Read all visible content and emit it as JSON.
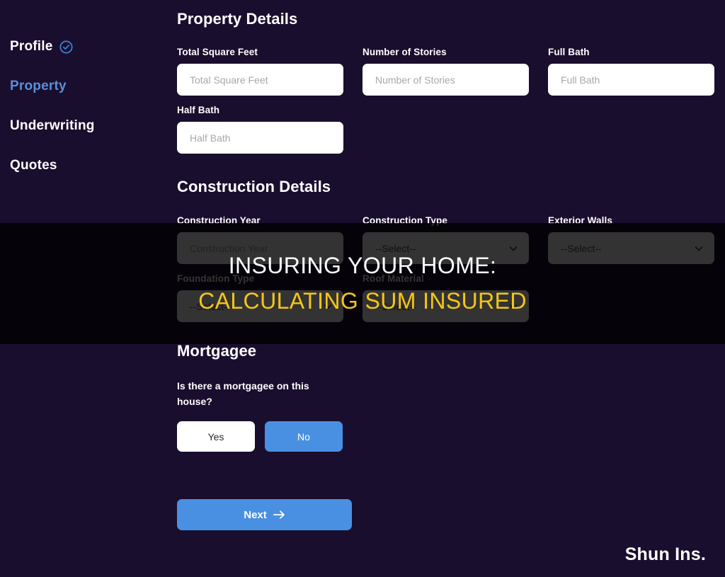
{
  "sidebar": {
    "items": [
      {
        "label": "Profile",
        "state": "complete",
        "icon": "check-circle-icon"
      },
      {
        "label": "Property",
        "state": "active",
        "icon": ""
      },
      {
        "label": "Underwriting",
        "state": "default",
        "icon": ""
      },
      {
        "label": "Quotes",
        "state": "default",
        "icon": ""
      }
    ]
  },
  "form": {
    "property_details": {
      "title": "Property Details",
      "fields": [
        {
          "label": "Total Square Feet",
          "placeholder": "Total Square Feet",
          "value": "",
          "type": "text"
        },
        {
          "label": "Number of Stories",
          "placeholder": "Number of Stories",
          "value": "",
          "type": "text"
        },
        {
          "label": "Full Bath",
          "placeholder": "Full Bath",
          "value": "",
          "type": "text"
        },
        {
          "label": "Half Bath",
          "placeholder": "Half Bath",
          "value": "",
          "type": "text"
        }
      ]
    },
    "construction_details": {
      "title": "Construction Details",
      "fields": [
        {
          "label": "Construction Year",
          "placeholder": "Construction Year",
          "value": "",
          "type": "text"
        },
        {
          "label": "Construction Type",
          "placeholder": "--Select--",
          "value": "--Select--",
          "type": "select"
        },
        {
          "label": "Exterior Walls",
          "placeholder": "--Select--",
          "value": "--Select--",
          "type": "select"
        },
        {
          "label": "Foundation Type",
          "placeholder": "--Select--",
          "value": "--Select--",
          "type": "select"
        },
        {
          "label": "Roof Material",
          "placeholder": "--Select--",
          "value": "--Select--",
          "type": "select"
        }
      ]
    },
    "mortgagee": {
      "title": "Mortgagee",
      "question": "Is there a mortgagee on this house?",
      "options": [
        {
          "label": "Yes",
          "selected": false
        },
        {
          "label": "No",
          "selected": true
        }
      ]
    },
    "next_button": {
      "label": "Next",
      "icon": "arrow-right-icon"
    }
  },
  "overlay": {
    "line1": "INSURING YOUR HOME:",
    "line2": "CALCULATING SUM INSURED"
  },
  "watermark": {
    "text": "Shun Ins."
  },
  "colors": {
    "background": "#1a0e2e",
    "accent_blue": "#4a90e2",
    "active_nav": "#5a8fd8",
    "overlay_yellow": "#f5c518",
    "input_white": "#ffffff"
  }
}
